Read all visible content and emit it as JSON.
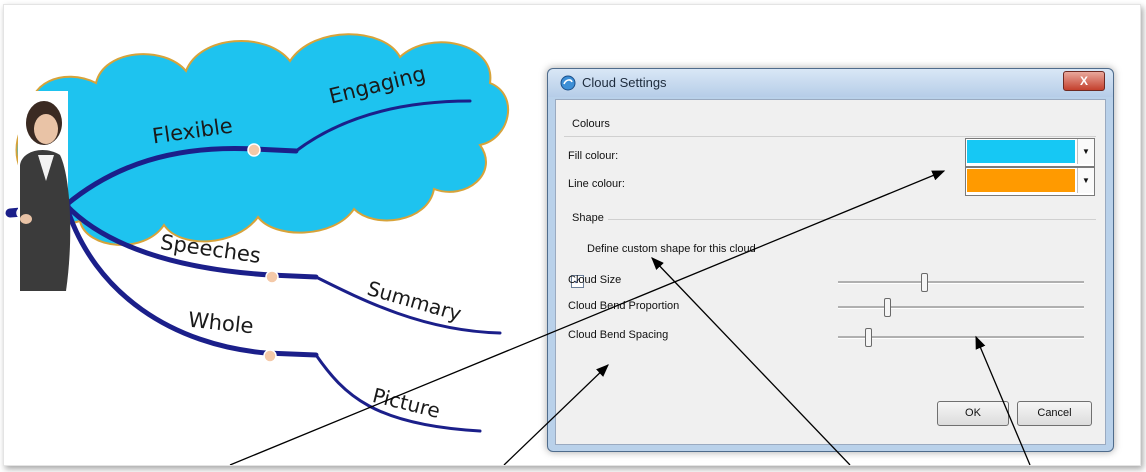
{
  "mindmap": {
    "branches": [
      {
        "label": "Flexible"
      },
      {
        "label": "Engaging"
      },
      {
        "label": "Speeches"
      },
      {
        "label": "Summary"
      },
      {
        "label": "Whole"
      },
      {
        "label": "Picture"
      }
    ],
    "colors": {
      "cloud_fill": "#1ec3ef",
      "cloud_line": "#d7a33a",
      "branch": "#1b1f8a"
    }
  },
  "dialog": {
    "title": "Cloud Settings",
    "close_label": "X",
    "colours_group": "Colours",
    "fill_label": "Fill colour:",
    "fill_color": "#16c8f4",
    "line_label": "Line colour:",
    "line_color": "#ff9a00",
    "shape_group": "Shape",
    "custom_shape_label": "Define custom shape for this cloud",
    "custom_shape_checked": true,
    "sliders": [
      {
        "label": "Cloud Size",
        "value": 0.35
      },
      {
        "label": "Cloud Bend Proportion",
        "value": 0.2
      },
      {
        "label": "Cloud Bend Spacing",
        "value": 0.12
      }
    ],
    "ok_label": "OK",
    "cancel_label": "Cancel"
  }
}
